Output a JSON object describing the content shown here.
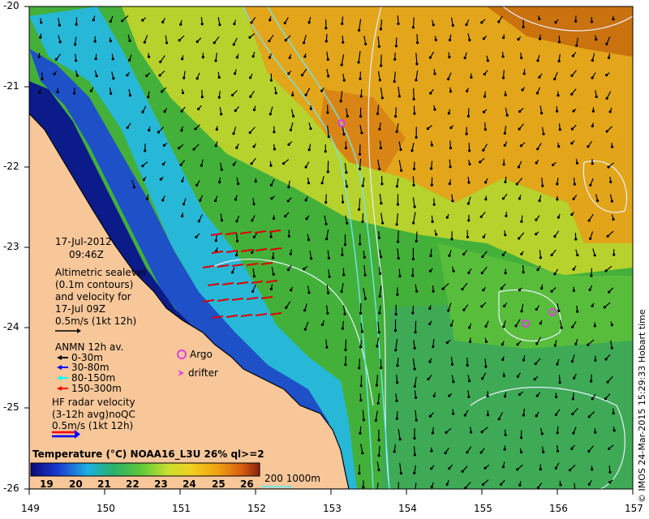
{
  "map": {
    "lon_ticks": [
      "149",
      "150",
      "151",
      "152",
      "153",
      "154",
      "155",
      "156",
      "157"
    ],
    "lat_ticks": [
      "-20",
      "-21",
      "-22",
      "-23",
      "-24",
      "-25",
      "-26"
    ],
    "colorbar_ticks": [
      "19",
      "20",
      "21",
      "22",
      "23",
      "24",
      "25",
      "26"
    ],
    "colors": {
      "land": "#f7c79a",
      "deep_blue": "#0a1a8c",
      "blue": "#1e50c8",
      "cyan": "#27b8d8",
      "green": "#2ea84a",
      "lightgreen": "#7fd23a",
      "yellow": "#e8d21c",
      "orange": "#e89a14",
      "dark_orange": "#c86a0c"
    }
  },
  "legend": {
    "date": "17-Jul-2012",
    "time": "09:46Z",
    "altimetric": [
      "Altimetric sealevel",
      "(0.1m contours)",
      "and velocity for",
      "17-Jul 09Z",
      "0.5m/s (1kt 12h)"
    ],
    "anmn_title": "ANMN 12h av.",
    "anmn_items": [
      {
        "label": "0-30m",
        "color": "#000000"
      },
      {
        "label": "30-80m",
        "color": "#0000ff"
      },
      {
        "label": "80-150m",
        "color": "#00ffff"
      },
      {
        "label": "150-300m",
        "color": "#ff0000"
      }
    ],
    "argo": "Argo",
    "drifter": "drifter",
    "hf": [
      "HF radar velocity",
      "(3-12h avg)noQC",
      "0.5m/s (1kt 12h)"
    ],
    "colorbar_title": "Temperature (°C) NOAA16_L3U 26% ql>=2",
    "depth_label": "200  1000m",
    "side_text": "© IMOS 24-Mar-2015 15:29:33 Hobart time"
  }
}
